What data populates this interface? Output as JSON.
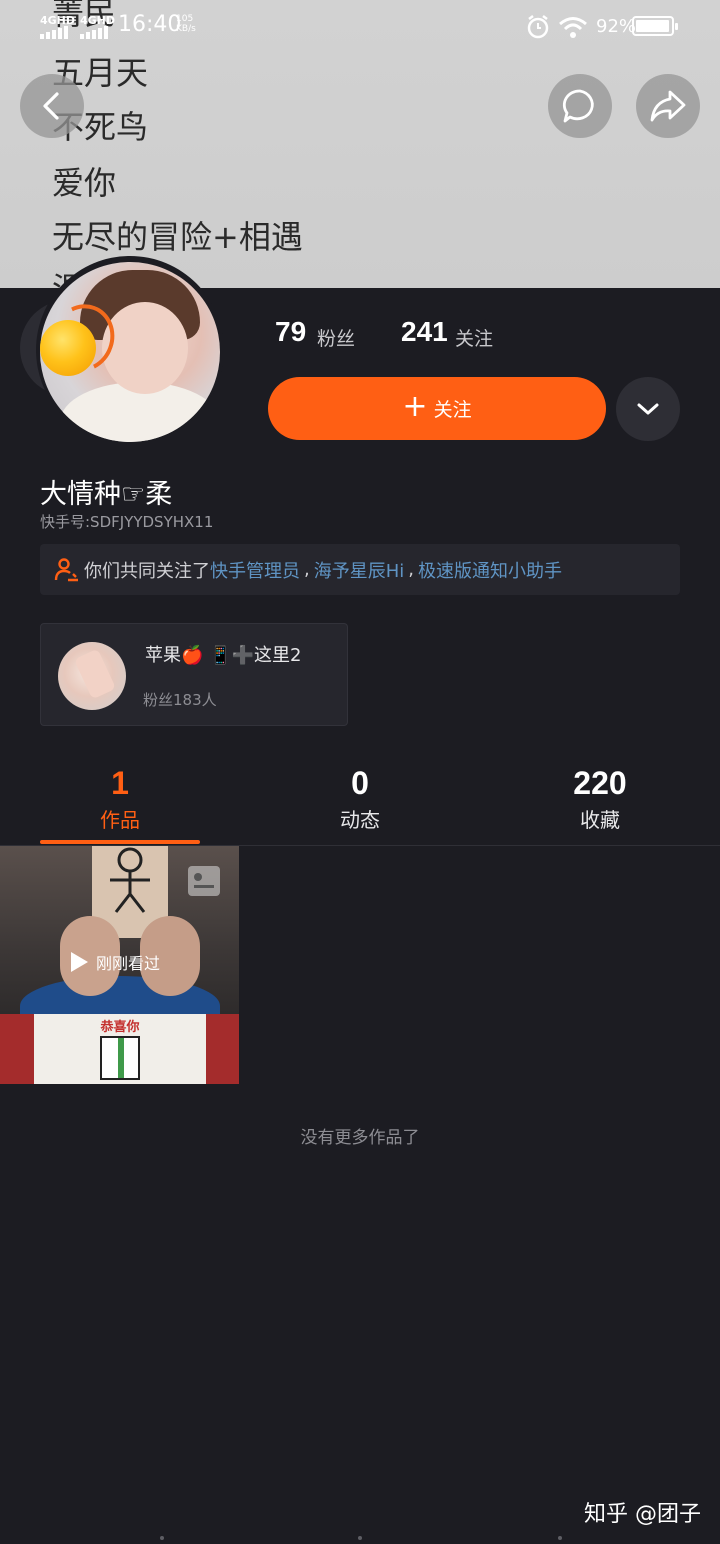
{
  "status_bar": {
    "signal1": "4GHD",
    "signal2": "4GHD",
    "time": "16:40",
    "net_speed_value": "105",
    "net_speed_unit": "KB/s",
    "battery_percent": "92%"
  },
  "cover": {
    "lines": [
      "菁民",
      "五月天",
      "不死鸟",
      "爱你",
      "无尽的冒险+相遇",
      "温"
    ]
  },
  "profile": {
    "fans_count": "79",
    "fans_label": "粉丝",
    "following_count": "241",
    "following_label": "关注",
    "follow_button_label": "关注",
    "follow_button_plus": "+",
    "username": "大情种☞柔",
    "user_id": "快手号:SDFJYYDSYHX11"
  },
  "mutual": {
    "prefix": "你们共同关注了",
    "users": [
      "快手管理员",
      "海予星辰Hi",
      "极速版通知小助手"
    ],
    "separator": ","
  },
  "related": {
    "title": "苹果🍎 📱➕这里2",
    "subtitle": "粉丝183人"
  },
  "tabs": [
    {
      "count": "1",
      "label": "作品",
      "active": true
    },
    {
      "count": "0",
      "label": "动态",
      "active": false
    },
    {
      "count": "220",
      "label": "收藏",
      "active": false
    }
  ],
  "work": {
    "seen_label": "刚刚看过",
    "card_title": "恭喜你"
  },
  "no_more_text": "没有更多作品了",
  "watermark": "知乎 @团子",
  "colors": {
    "accent": "#ff5f14",
    "background": "#1c1c22",
    "link": "#5f94c4"
  },
  "icons": [
    "back-icon",
    "comment-icon",
    "share-icon",
    "chevron-down-icon",
    "user-heart-icon",
    "play-icon",
    "multi-photo-icon",
    "alarm-icon",
    "wifi-icon",
    "battery-icon"
  ]
}
